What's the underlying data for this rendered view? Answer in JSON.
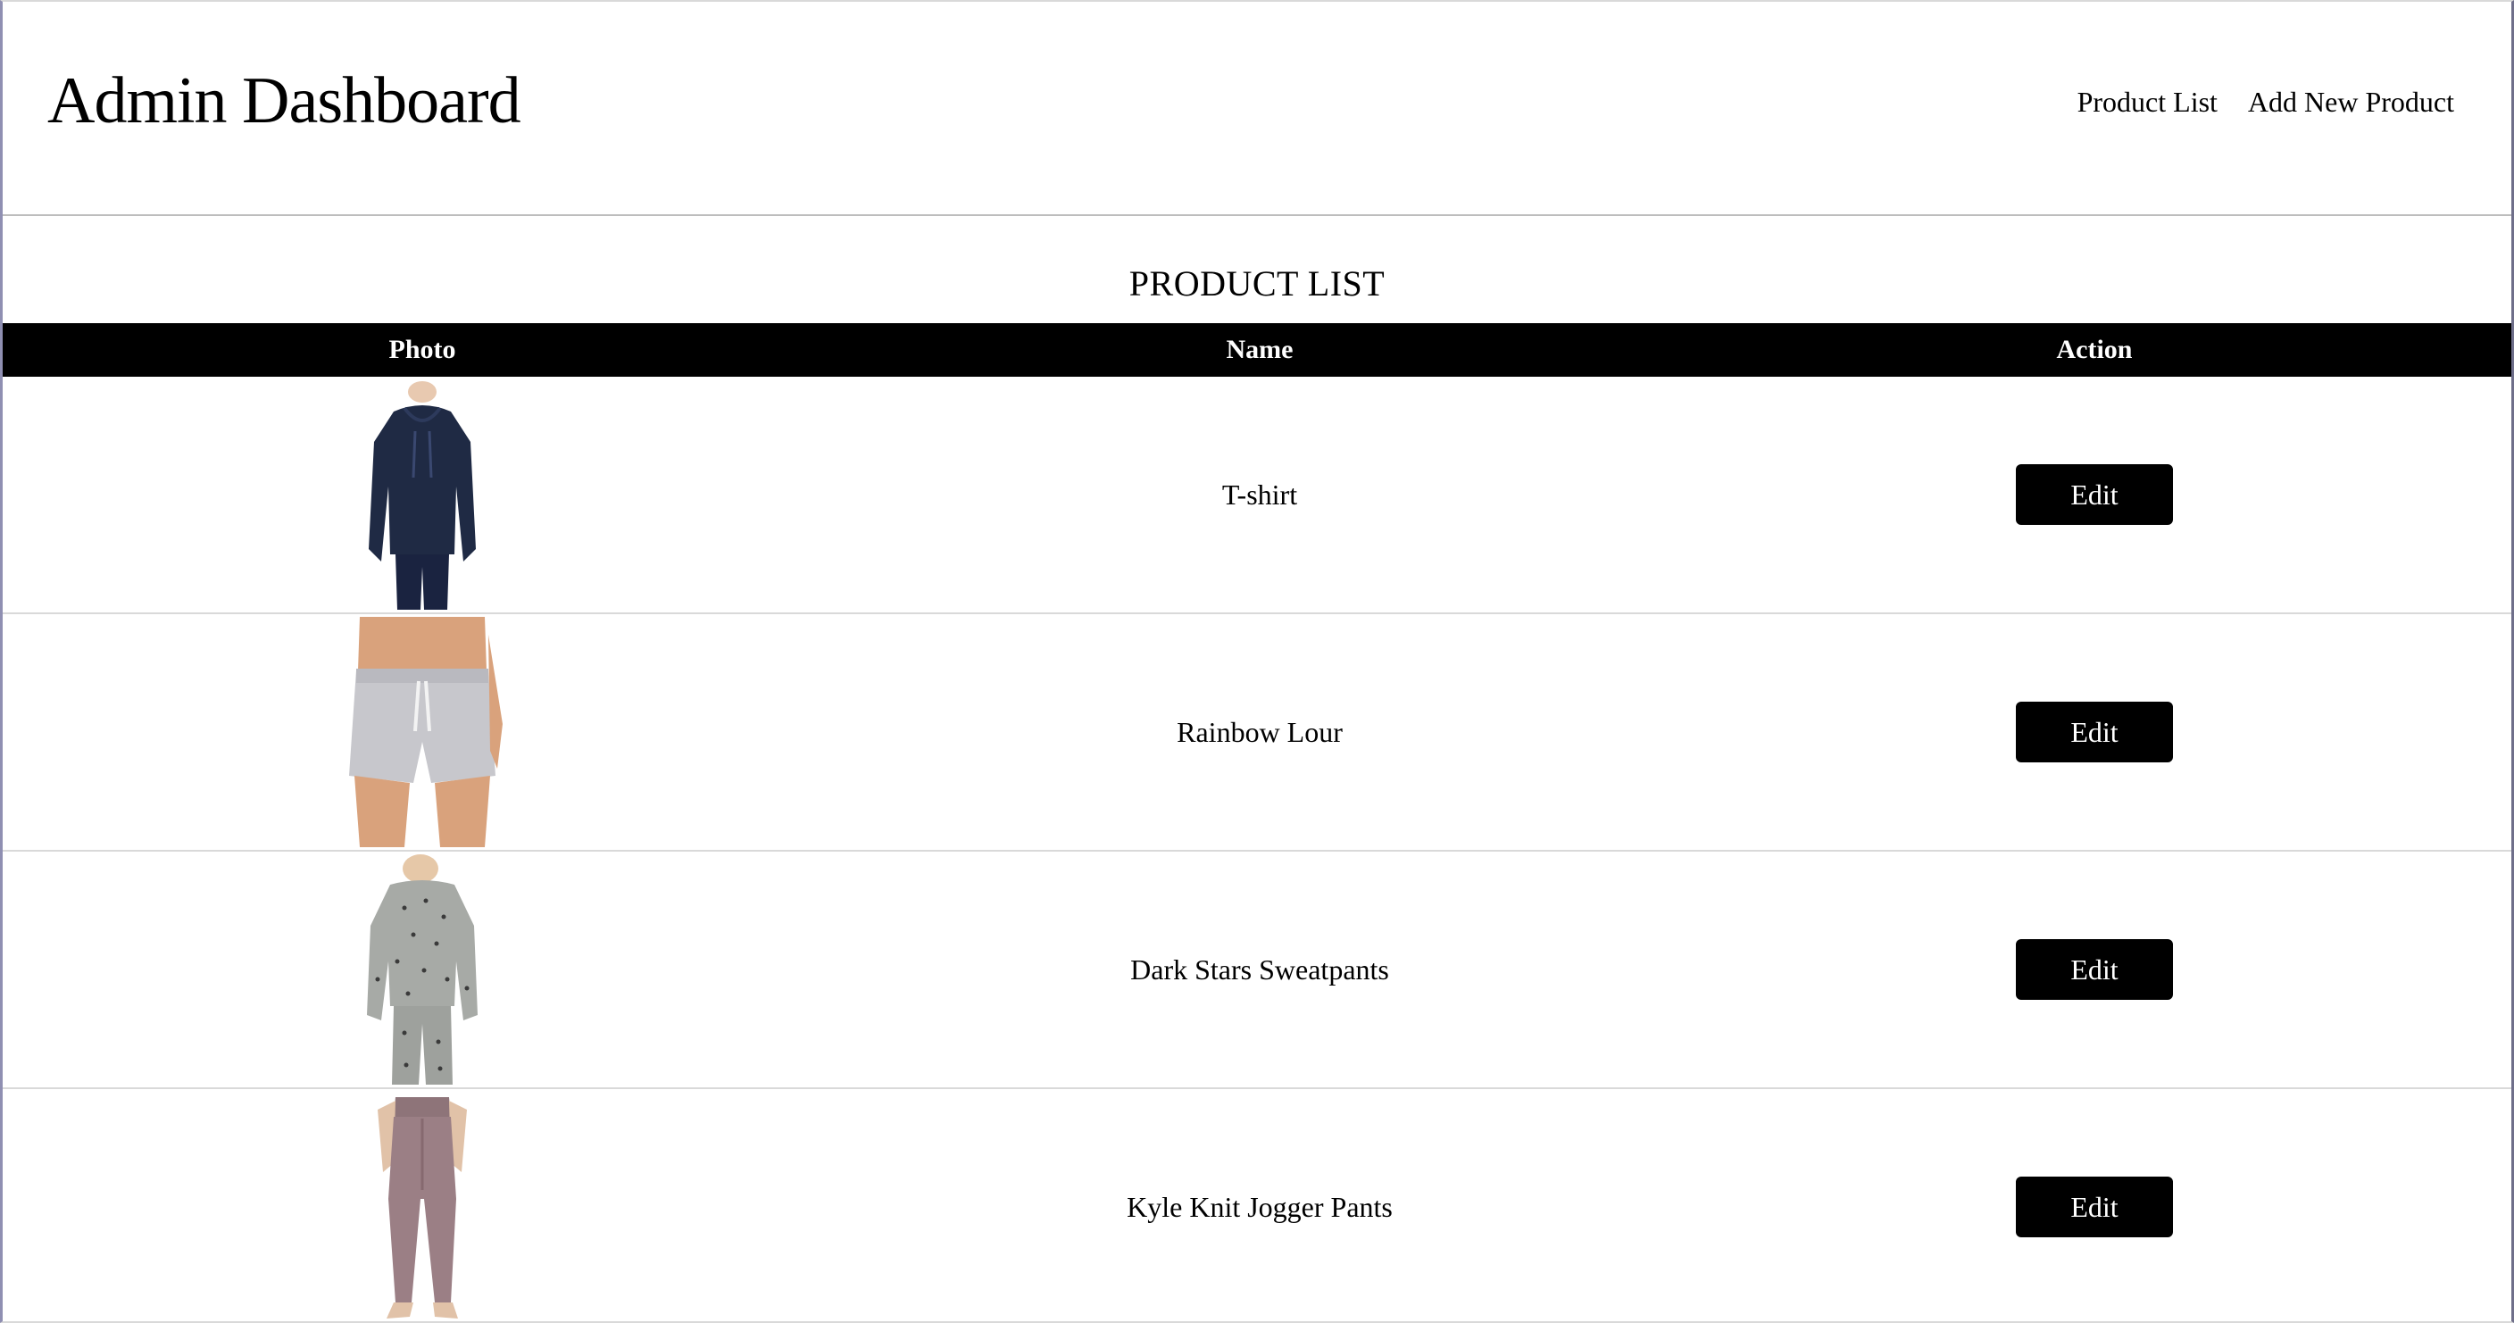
{
  "header": {
    "title": "Admin Dashboard",
    "nav": [
      {
        "label": "Product List"
      },
      {
        "label": "Add New Product"
      }
    ]
  },
  "main": {
    "section_title": "PRODUCT LIST",
    "columns": [
      "Photo",
      "Name",
      "Action"
    ],
    "products": [
      {
        "name": "T-shirt",
        "action_label": "Edit",
        "photo_icon": "navy-hoodie-outfit-photo",
        "photo_color": "#1f2a44"
      },
      {
        "name": "Rainbow Lour",
        "action_label": "Edit",
        "photo_icon": "gray-shorts-photo",
        "photo_color": "#c7c7cc"
      },
      {
        "name": "Dark Stars Sweatpants",
        "action_label": "Edit",
        "photo_icon": "gray-star-print-lounge-set-photo",
        "photo_color": "#a7aaa6"
      },
      {
        "name": "Kyle Knit Jogger Pants",
        "action_label": "Edit",
        "photo_icon": "mauve-jogger-pants-photo",
        "photo_color": "#9b7f85"
      }
    ]
  },
  "colors": {
    "header_bg": "#000000",
    "button_bg": "#000000",
    "button_text": "#ffffff"
  }
}
